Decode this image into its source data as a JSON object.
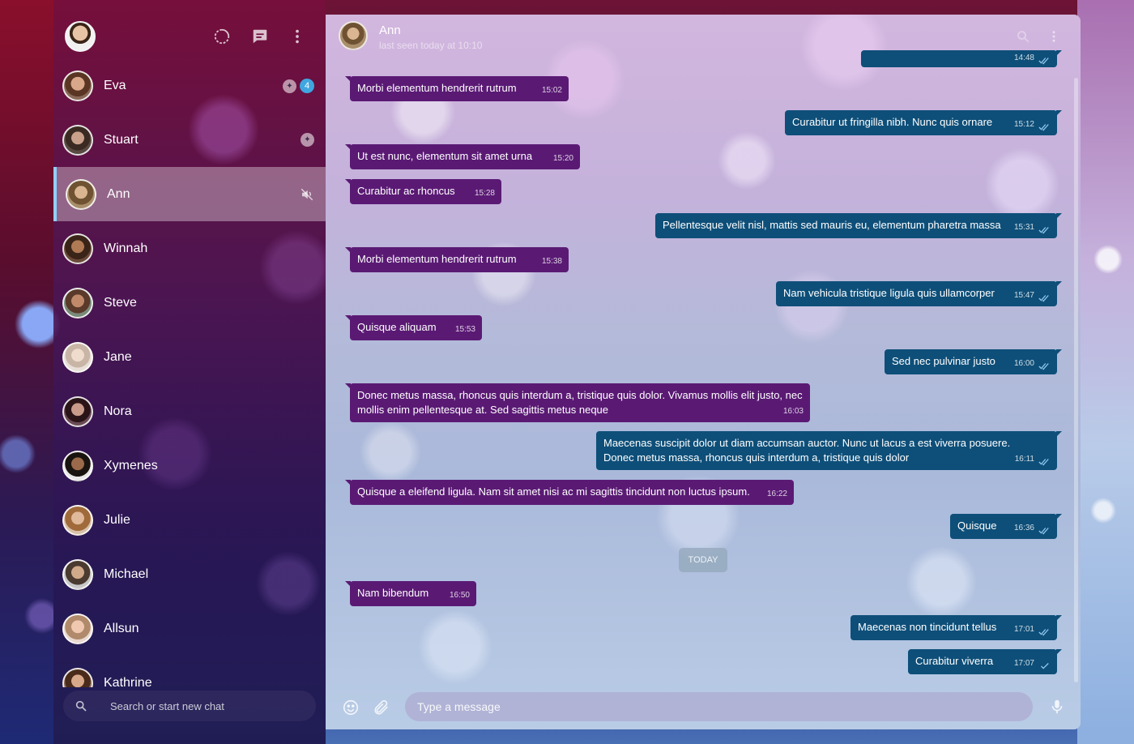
{
  "sidebar": {
    "header_icons": [
      "status-icon",
      "new-chat-icon",
      "more-vert-icon"
    ],
    "chats": [
      {
        "name": "Eva",
        "pinned": true,
        "unread": "4",
        "avatar_color": "#b07a5a"
      },
      {
        "name": "Stuart",
        "pinned": true,
        "avatar_color": "#6a5a52"
      },
      {
        "name": "Ann",
        "muted": true,
        "active": true,
        "avatar_color": "#8a7052"
      },
      {
        "name": "Winnah",
        "avatar_color": "#5b3a2a"
      },
      {
        "name": "Steve",
        "avatar_color": "#6b4a3a"
      },
      {
        "name": "Jane",
        "avatar_color": "#d9c4b5"
      },
      {
        "name": "Nora",
        "avatar_color": "#4a2a35"
      },
      {
        "name": "Xymenes",
        "avatar_color": "#3a2a22"
      },
      {
        "name": "Julie",
        "avatar_color": "#b38a6a"
      },
      {
        "name": "Michael",
        "avatar_color": "#7a6a5a"
      },
      {
        "name": "Allsun",
        "avatar_color": "#c9a28a"
      },
      {
        "name": "Kathrine",
        "avatar_color": "#6a4a3a"
      }
    ],
    "search_placeholder": "Search or start new chat"
  },
  "chat": {
    "contact_name": "Ann",
    "status": "last seen today at 10:10",
    "messages": [
      {
        "dir": "out",
        "text": "",
        "time": "14:48"
      },
      {
        "dir": "in",
        "text": "Morbi elementum hendrerit rutrum",
        "time": "15:02"
      },
      {
        "dir": "out",
        "text": "Curabitur ut fringilla nibh. Nunc quis ornare",
        "time": "15:12"
      },
      {
        "dir": "in",
        "text": "Ut est nunc, elementum sit amet urna",
        "time": "15:20"
      },
      {
        "dir": "in",
        "text": "Curabitur ac rhoncus",
        "time": "15:28"
      },
      {
        "dir": "out",
        "text": "Pellentesque velit nisl, mattis sed mauris eu, elementum pharetra massa",
        "time": "15:31"
      },
      {
        "dir": "in",
        "text": "Morbi elementum hendrerit rutrum",
        "time": "15:38"
      },
      {
        "dir": "out",
        "text": "Nam vehicula tristique ligula quis ullamcorper",
        "time": "15:47"
      },
      {
        "dir": "in",
        "text": "Quisque aliquam",
        "time": "15:53"
      },
      {
        "dir": "out",
        "text": "Sed nec pulvinar justo",
        "time": "16:00"
      },
      {
        "dir": "in",
        "text": "Donec metus massa, rhoncus quis interdum a, tristique quis dolor. Vivamus mollis elit justo, nec mollis enim pellentesque at. Sed sagittis metus neque",
        "time": "16:03"
      },
      {
        "dir": "out",
        "text": "Maecenas suscipit dolor ut diam accumsan auctor. Nunc ut lacus a est viverra posuere. Donec metus massa, rhoncus quis interdum a, tristique quis dolor",
        "time": "16:11"
      },
      {
        "dir": "in",
        "text": "Quisque a eleifend ligula. Nam sit amet nisi ac mi sagittis tincidunt non luctus ipsum.",
        "time": "16:22"
      },
      {
        "dir": "out",
        "text": "Quisque",
        "time": "16:36"
      },
      {
        "dir": "in",
        "text": "Nam bibendum",
        "time": "16:50"
      },
      {
        "dir": "out",
        "text": "Maecenas non tincidunt tellus",
        "time": "17:01"
      },
      {
        "dir": "out",
        "text": "Curabitur viverra",
        "time": "17:07"
      }
    ],
    "day_separator": "TODAY",
    "composer_placeholder": "Type a message"
  },
  "colors": {
    "incoming_bubble": "#5a1a74",
    "outgoing_bubble": "#0e4f79",
    "active_indicator": "#8fd0ff",
    "unread_badge": "#3fa6e0"
  }
}
